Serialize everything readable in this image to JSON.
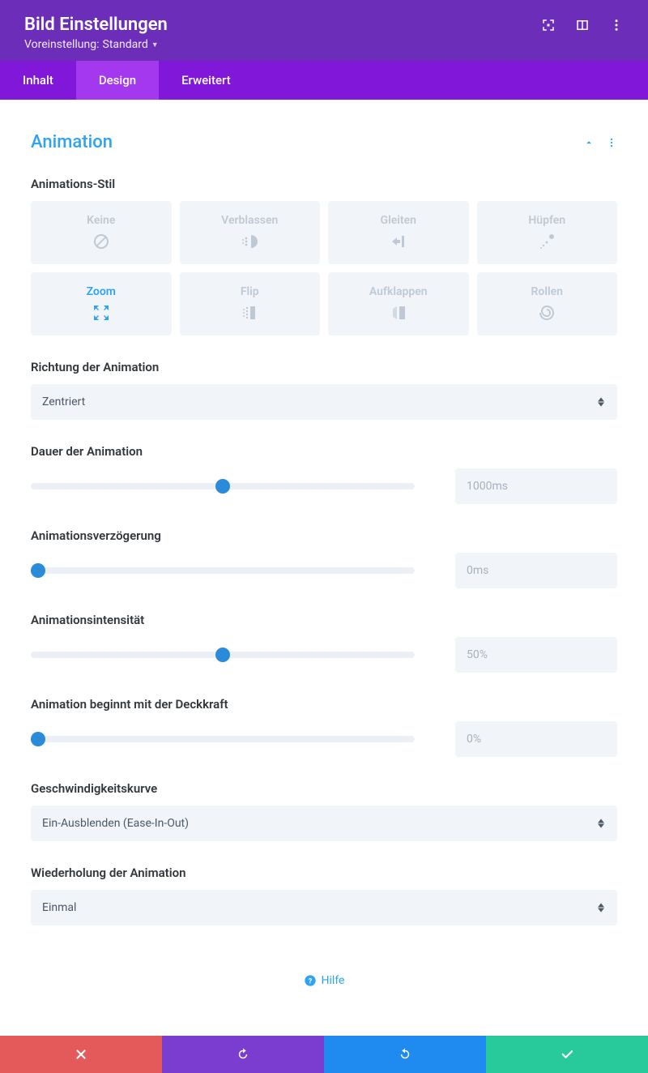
{
  "header": {
    "title": "Bild Einstellungen",
    "preset_prefix": "Voreinstellung:",
    "preset_value": "Standard"
  },
  "tabs": {
    "content": "Inhalt",
    "design": "Design",
    "advanced": "Erweitert"
  },
  "section": {
    "title": "Animation"
  },
  "labels": {
    "style": "Animations-Stil",
    "direction": "Richtung der Animation",
    "duration": "Dauer der Animation",
    "delay": "Animationsverzögerung",
    "intensity": "Animationsintensität",
    "opacity": "Animation beginnt mit der Deckkraft",
    "speed_curve": "Geschwindigkeitskurve",
    "repeat": "Wiederholung der Animation"
  },
  "styles": {
    "none": "Keine",
    "fade": "Verblassen",
    "slide": "Gleiten",
    "bounce": "Hüpfen",
    "zoom": "Zoom",
    "flip": "Flip",
    "fold": "Aufklappen",
    "roll": "Rollen"
  },
  "values": {
    "direction": "Zentriert",
    "duration": "1000ms",
    "delay": "0ms",
    "intensity": "50%",
    "opacity": "0%",
    "speed_curve": "Ein-Ausblenden (Ease-In-Out)",
    "repeat": "Einmal"
  },
  "slider_pos": {
    "duration": 50,
    "delay": 2,
    "intensity": 50,
    "opacity": 2
  },
  "help": "Hilfe"
}
